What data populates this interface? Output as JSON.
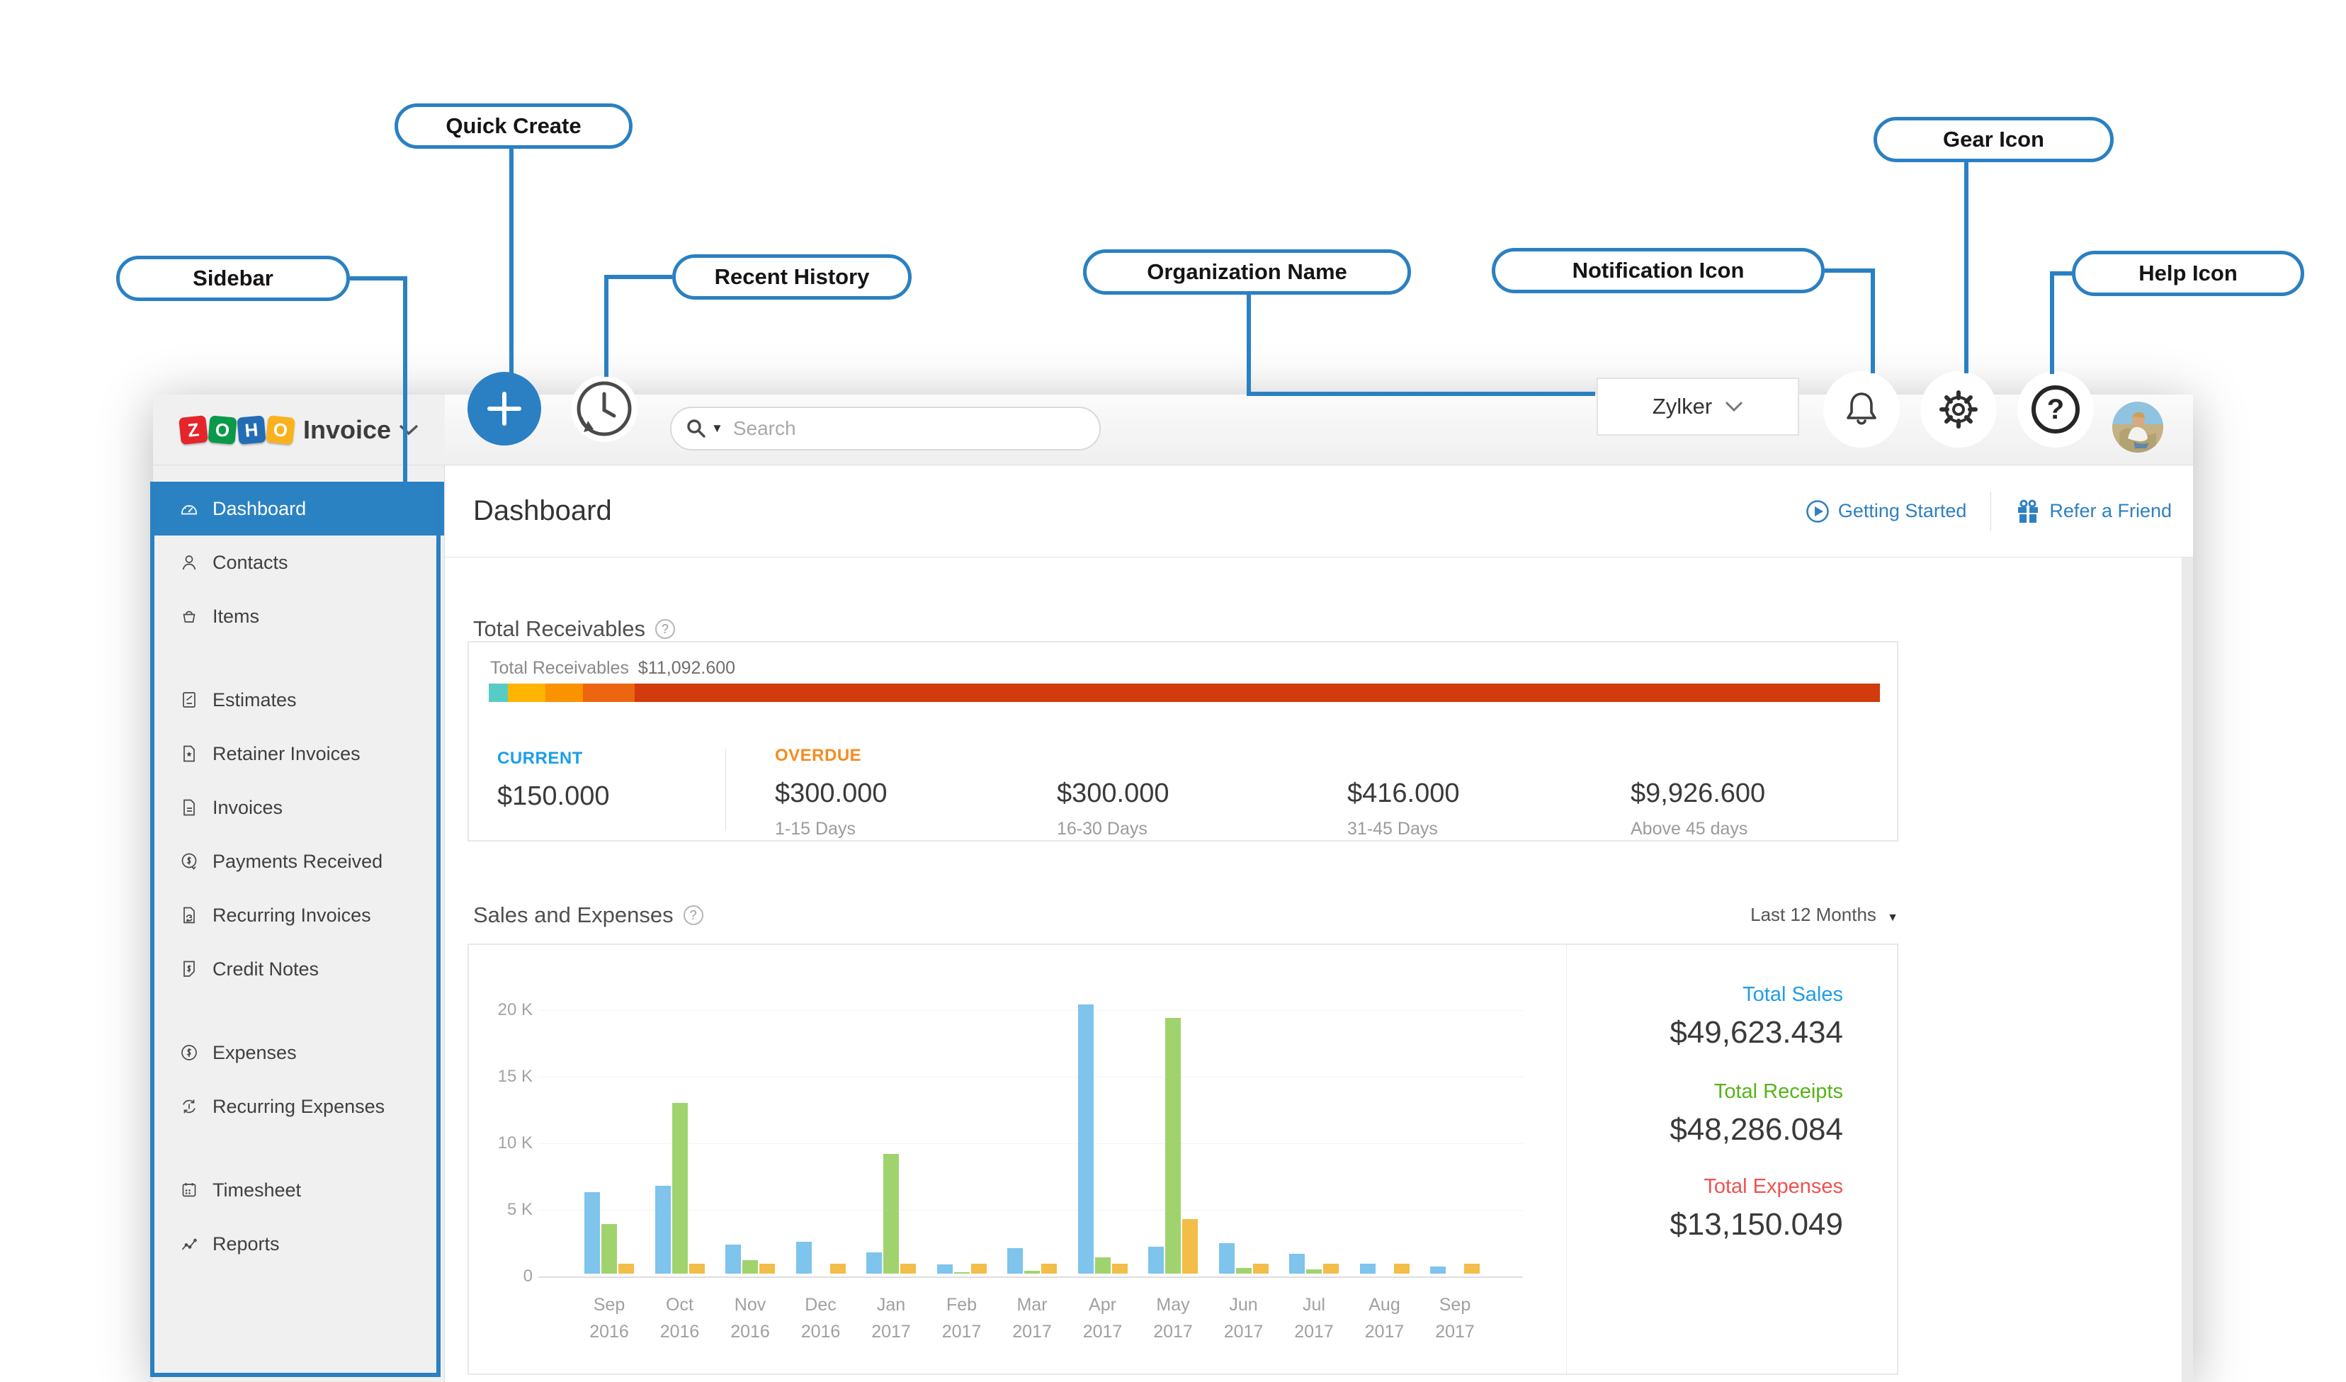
{
  "logo": {
    "boxes": [
      {
        "letter": "Z",
        "color": "#e4252b"
      },
      {
        "letter": "O",
        "color": "#089949"
      },
      {
        "letter": "H",
        "color": "#226db4"
      },
      {
        "letter": "O",
        "color": "#f9b21d"
      }
    ],
    "product": "Invoice"
  },
  "topbar": {
    "search_placeholder": "Search",
    "org_name": "Zylker"
  },
  "header": {
    "title": "Dashboard",
    "getting_started": "Getting Started",
    "refer_friend": "Refer a Friend"
  },
  "sidebar": {
    "items": [
      {
        "label": "Dashboard",
        "icon": "dashboard",
        "active": true,
        "gap": false
      },
      {
        "label": "Contacts",
        "icon": "contacts",
        "active": false,
        "gap": false
      },
      {
        "label": "Items",
        "icon": "items",
        "active": false,
        "gap": false
      },
      {
        "label": "Estimates",
        "icon": "estimates",
        "active": false,
        "gap": true
      },
      {
        "label": "Retainer Invoices",
        "icon": "retainer",
        "active": false,
        "gap": false
      },
      {
        "label": "Invoices",
        "icon": "invoices",
        "active": false,
        "gap": false
      },
      {
        "label": "Payments Received",
        "icon": "payments",
        "active": false,
        "gap": false
      },
      {
        "label": "Recurring Invoices",
        "icon": "recurring_inv",
        "active": false,
        "gap": false
      },
      {
        "label": "Credit Notes",
        "icon": "credit_notes",
        "active": false,
        "gap": false
      },
      {
        "label": "Expenses",
        "icon": "expenses",
        "active": false,
        "gap": true
      },
      {
        "label": "Recurring Expenses",
        "icon": "recurring_exp",
        "active": false,
        "gap": false
      },
      {
        "label": "Timesheet",
        "icon": "timesheet",
        "active": false,
        "gap": true
      },
      {
        "label": "Reports",
        "icon": "reports",
        "active": false,
        "gap": false
      }
    ]
  },
  "receivables": {
    "heading": "Total Receivables",
    "summary_label": "Total Receivables",
    "summary_value": "$11,092.600",
    "total": 11092.6,
    "segments": [
      {
        "name": "current",
        "value": 150,
        "color": "#57ccc4"
      },
      {
        "name": "overdue-1-15",
        "value": 300,
        "color": "#fdb501"
      },
      {
        "name": "overdue-16-30",
        "value": 300,
        "color": "#fb9300"
      },
      {
        "name": "overdue-31-45",
        "value": 416,
        "color": "#ec6510"
      },
      {
        "name": "overdue-above-45",
        "value": 9926.6,
        "color": "#d23b0d"
      }
    ],
    "current": {
      "label": "CURRENT",
      "amount": "$150.000",
      "color": "#1a9fe8"
    },
    "overdue_label": "OVERDUE",
    "overdue_color": "#f58c1f",
    "aging": [
      {
        "amount": "$300.000",
        "period": "1-15 Days"
      },
      {
        "amount": "$300.000",
        "period": "16-30 Days"
      },
      {
        "amount": "$416.000",
        "period": "31-45 Days"
      },
      {
        "amount": "$9,926.600",
        "period": "Above 45 days"
      }
    ]
  },
  "sales": {
    "heading": "Sales and Expenses",
    "range_label": "Last 12 Months",
    "totals": [
      {
        "label": "Total Sales",
        "value": "$49,623.434",
        "color": "#1e9de5"
      },
      {
        "label": "Total Receipts",
        "value": "$48,286.084",
        "color": "#57b317"
      },
      {
        "label": "Total Expenses",
        "value": "$13,150.049",
        "color": "#ef5251"
      }
    ]
  },
  "chart_data": {
    "type": "bar",
    "title": "Sales and Expenses",
    "categories": [
      {
        "month": "Sep",
        "year": "2016"
      },
      {
        "month": "Oct",
        "year": "2016"
      },
      {
        "month": "Nov",
        "year": "2016"
      },
      {
        "month": "Dec",
        "year": "2016"
      },
      {
        "month": "Jan",
        "year": "2017"
      },
      {
        "month": "Feb",
        "year": "2017"
      },
      {
        "month": "Mar",
        "year": "2017"
      },
      {
        "month": "Apr",
        "year": "2017"
      },
      {
        "month": "May",
        "year": "2017"
      },
      {
        "month": "Jun",
        "year": "2017"
      },
      {
        "month": "Jul",
        "year": "2017"
      },
      {
        "month": "Aug",
        "year": "2017"
      },
      {
        "month": "Sep",
        "year": "2017"
      }
    ],
    "series": [
      {
        "name": "Sales",
        "color": "#7ec4ec",
        "values": [
          6100,
          6600,
          2200,
          2400,
          1600,
          700,
          1900,
          20200,
          2000,
          2300,
          1500,
          750,
          550
        ]
      },
      {
        "name": "Receipts",
        "color": "#a0d36e",
        "values": [
          3700,
          12800,
          1000,
          0,
          9000,
          80,
          200,
          1200,
          19200,
          450,
          300,
          0,
          0
        ]
      },
      {
        "name": "Expenses",
        "color": "#f2bd49",
        "values": [
          750,
          750,
          750,
          750,
          750,
          750,
          750,
          750,
          4100,
          750,
          750,
          750,
          750
        ]
      }
    ],
    "ylim": [
      0,
      20000
    ],
    "yticks": [
      {
        "value": 20000,
        "label": "20 K"
      },
      {
        "value": 15000,
        "label": "15 K"
      },
      {
        "value": 10000,
        "label": "10 K"
      },
      {
        "value": 5000,
        "label": "5 K"
      },
      {
        "value": 0,
        "label": "0"
      }
    ],
    "grid": true,
    "legend_position": "right-totals"
  },
  "annotations": {
    "quick_create": "Quick Create",
    "sidebar": "Sidebar",
    "recent_history": "Recent History",
    "organization_name": "Organization Name",
    "notification_icon": "Notification Icon",
    "gear_icon": "Gear Icon",
    "help_icon": "Help Icon"
  },
  "accent": {
    "callout_blue": "#2a80c2",
    "active_blue": "#2b82c3"
  }
}
